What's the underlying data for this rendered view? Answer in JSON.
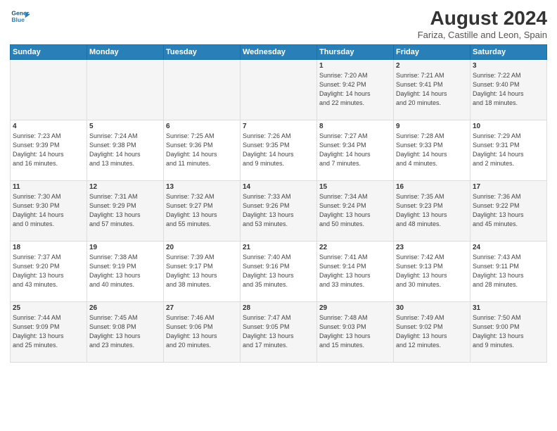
{
  "header": {
    "logo_line1": "General",
    "logo_line2": "Blue",
    "month": "August 2024",
    "location": "Fariza, Castille and Leon, Spain"
  },
  "weekdays": [
    "Sunday",
    "Monday",
    "Tuesday",
    "Wednesday",
    "Thursday",
    "Friday",
    "Saturday"
  ],
  "weeks": [
    [
      {
        "day": "",
        "info": ""
      },
      {
        "day": "",
        "info": ""
      },
      {
        "day": "",
        "info": ""
      },
      {
        "day": "",
        "info": ""
      },
      {
        "day": "1",
        "info": "Sunrise: 7:20 AM\nSunset: 9:42 PM\nDaylight: 14 hours\nand 22 minutes."
      },
      {
        "day": "2",
        "info": "Sunrise: 7:21 AM\nSunset: 9:41 PM\nDaylight: 14 hours\nand 20 minutes."
      },
      {
        "day": "3",
        "info": "Sunrise: 7:22 AM\nSunset: 9:40 PM\nDaylight: 14 hours\nand 18 minutes."
      }
    ],
    [
      {
        "day": "4",
        "info": "Sunrise: 7:23 AM\nSunset: 9:39 PM\nDaylight: 14 hours\nand 16 minutes."
      },
      {
        "day": "5",
        "info": "Sunrise: 7:24 AM\nSunset: 9:38 PM\nDaylight: 14 hours\nand 13 minutes."
      },
      {
        "day": "6",
        "info": "Sunrise: 7:25 AM\nSunset: 9:36 PM\nDaylight: 14 hours\nand 11 minutes."
      },
      {
        "day": "7",
        "info": "Sunrise: 7:26 AM\nSunset: 9:35 PM\nDaylight: 14 hours\nand 9 minutes."
      },
      {
        "day": "8",
        "info": "Sunrise: 7:27 AM\nSunset: 9:34 PM\nDaylight: 14 hours\nand 7 minutes."
      },
      {
        "day": "9",
        "info": "Sunrise: 7:28 AM\nSunset: 9:33 PM\nDaylight: 14 hours\nand 4 minutes."
      },
      {
        "day": "10",
        "info": "Sunrise: 7:29 AM\nSunset: 9:31 PM\nDaylight: 14 hours\nand 2 minutes."
      }
    ],
    [
      {
        "day": "11",
        "info": "Sunrise: 7:30 AM\nSunset: 9:30 PM\nDaylight: 14 hours\nand 0 minutes."
      },
      {
        "day": "12",
        "info": "Sunrise: 7:31 AM\nSunset: 9:29 PM\nDaylight: 13 hours\nand 57 minutes."
      },
      {
        "day": "13",
        "info": "Sunrise: 7:32 AM\nSunset: 9:27 PM\nDaylight: 13 hours\nand 55 minutes."
      },
      {
        "day": "14",
        "info": "Sunrise: 7:33 AM\nSunset: 9:26 PM\nDaylight: 13 hours\nand 53 minutes."
      },
      {
        "day": "15",
        "info": "Sunrise: 7:34 AM\nSunset: 9:24 PM\nDaylight: 13 hours\nand 50 minutes."
      },
      {
        "day": "16",
        "info": "Sunrise: 7:35 AM\nSunset: 9:23 PM\nDaylight: 13 hours\nand 48 minutes."
      },
      {
        "day": "17",
        "info": "Sunrise: 7:36 AM\nSunset: 9:22 PM\nDaylight: 13 hours\nand 45 minutes."
      }
    ],
    [
      {
        "day": "18",
        "info": "Sunrise: 7:37 AM\nSunset: 9:20 PM\nDaylight: 13 hours\nand 43 minutes."
      },
      {
        "day": "19",
        "info": "Sunrise: 7:38 AM\nSunset: 9:19 PM\nDaylight: 13 hours\nand 40 minutes."
      },
      {
        "day": "20",
        "info": "Sunrise: 7:39 AM\nSunset: 9:17 PM\nDaylight: 13 hours\nand 38 minutes."
      },
      {
        "day": "21",
        "info": "Sunrise: 7:40 AM\nSunset: 9:16 PM\nDaylight: 13 hours\nand 35 minutes."
      },
      {
        "day": "22",
        "info": "Sunrise: 7:41 AM\nSunset: 9:14 PM\nDaylight: 13 hours\nand 33 minutes."
      },
      {
        "day": "23",
        "info": "Sunrise: 7:42 AM\nSunset: 9:13 PM\nDaylight: 13 hours\nand 30 minutes."
      },
      {
        "day": "24",
        "info": "Sunrise: 7:43 AM\nSunset: 9:11 PM\nDaylight: 13 hours\nand 28 minutes."
      }
    ],
    [
      {
        "day": "25",
        "info": "Sunrise: 7:44 AM\nSunset: 9:09 PM\nDaylight: 13 hours\nand 25 minutes."
      },
      {
        "day": "26",
        "info": "Sunrise: 7:45 AM\nSunset: 9:08 PM\nDaylight: 13 hours\nand 23 minutes."
      },
      {
        "day": "27",
        "info": "Sunrise: 7:46 AM\nSunset: 9:06 PM\nDaylight: 13 hours\nand 20 minutes."
      },
      {
        "day": "28",
        "info": "Sunrise: 7:47 AM\nSunset: 9:05 PM\nDaylight: 13 hours\nand 17 minutes."
      },
      {
        "day": "29",
        "info": "Sunrise: 7:48 AM\nSunset: 9:03 PM\nDaylight: 13 hours\nand 15 minutes."
      },
      {
        "day": "30",
        "info": "Sunrise: 7:49 AM\nSunset: 9:02 PM\nDaylight: 13 hours\nand 12 minutes."
      },
      {
        "day": "31",
        "info": "Sunrise: 7:50 AM\nSunset: 9:00 PM\nDaylight: 13 hours\nand 9 minutes."
      }
    ]
  ]
}
